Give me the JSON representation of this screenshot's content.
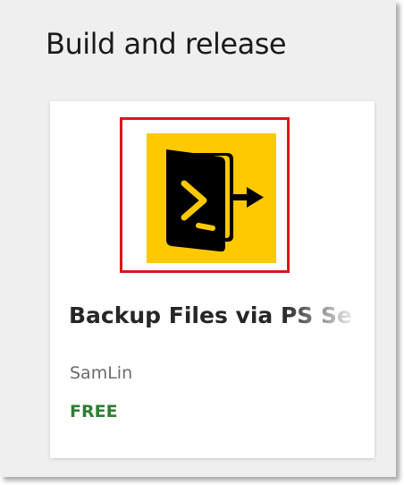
{
  "section": {
    "title": "Build and release"
  },
  "extension_card": {
    "icon": "powershell-export-icon",
    "name": "Backup Files via PS Se",
    "publisher": "SamLin",
    "price": "FREE"
  },
  "colors": {
    "icon_background": "#ffc900",
    "highlight_border": "#d9161c",
    "price_text": "#2f7d32"
  }
}
